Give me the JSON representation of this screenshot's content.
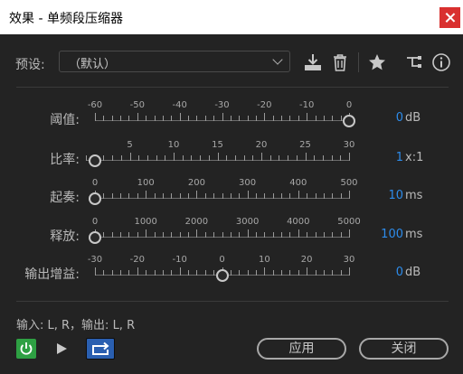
{
  "window": {
    "title": "效果 - 单频段压缩器"
  },
  "preset": {
    "label": "预设:",
    "value": "（默认）"
  },
  "toolbar": {
    "icons": [
      "download-icon",
      "trash-icon",
      "star-icon",
      "routing-icon",
      "info-icon"
    ]
  },
  "sliders": [
    {
      "label": "阈值:",
      "value": "0",
      "unit": "dB",
      "min": -60,
      "max": 0,
      "current": 0,
      "ticks": [
        "-60",
        "-50",
        "-40",
        "-30",
        "-20",
        "-10",
        "0"
      ]
    },
    {
      "label": "比率:",
      "value": "1",
      "unit": "x:1",
      "min": 0,
      "max": 30,
      "current": 1,
      "ticks": [
        "5",
        "10",
        "15",
        "20",
        "25",
        "30"
      ]
    },
    {
      "label": "起奏:",
      "value": "10",
      "unit": "ms",
      "min": 0,
      "max": 500,
      "current": 0,
      "ticks": [
        "0",
        "100",
        "200",
        "300",
        "400",
        "500"
      ]
    },
    {
      "label": "释放:",
      "value": "100",
      "unit": "ms",
      "min": 0,
      "max": 5000,
      "current": 0,
      "ticks": [
        "0",
        "1000",
        "2000",
        "3000",
        "4000",
        "5000"
      ]
    },
    {
      "label": "输出增益:",
      "value": "0",
      "unit": "dB",
      "min": -30,
      "max": 30,
      "current": 0,
      "ticks": [
        "-30",
        "-20",
        "-10",
        "0",
        "10",
        "20",
        "30"
      ]
    }
  ],
  "io": {
    "text": "输入: L, R，输出: L, R"
  },
  "buttons": {
    "apply": "应用",
    "close": "关闭"
  },
  "colors": {
    "accent": "#2d8ceb",
    "power": "#2ea043",
    "close": "#d9302f",
    "loop": "#2a5fb0"
  }
}
